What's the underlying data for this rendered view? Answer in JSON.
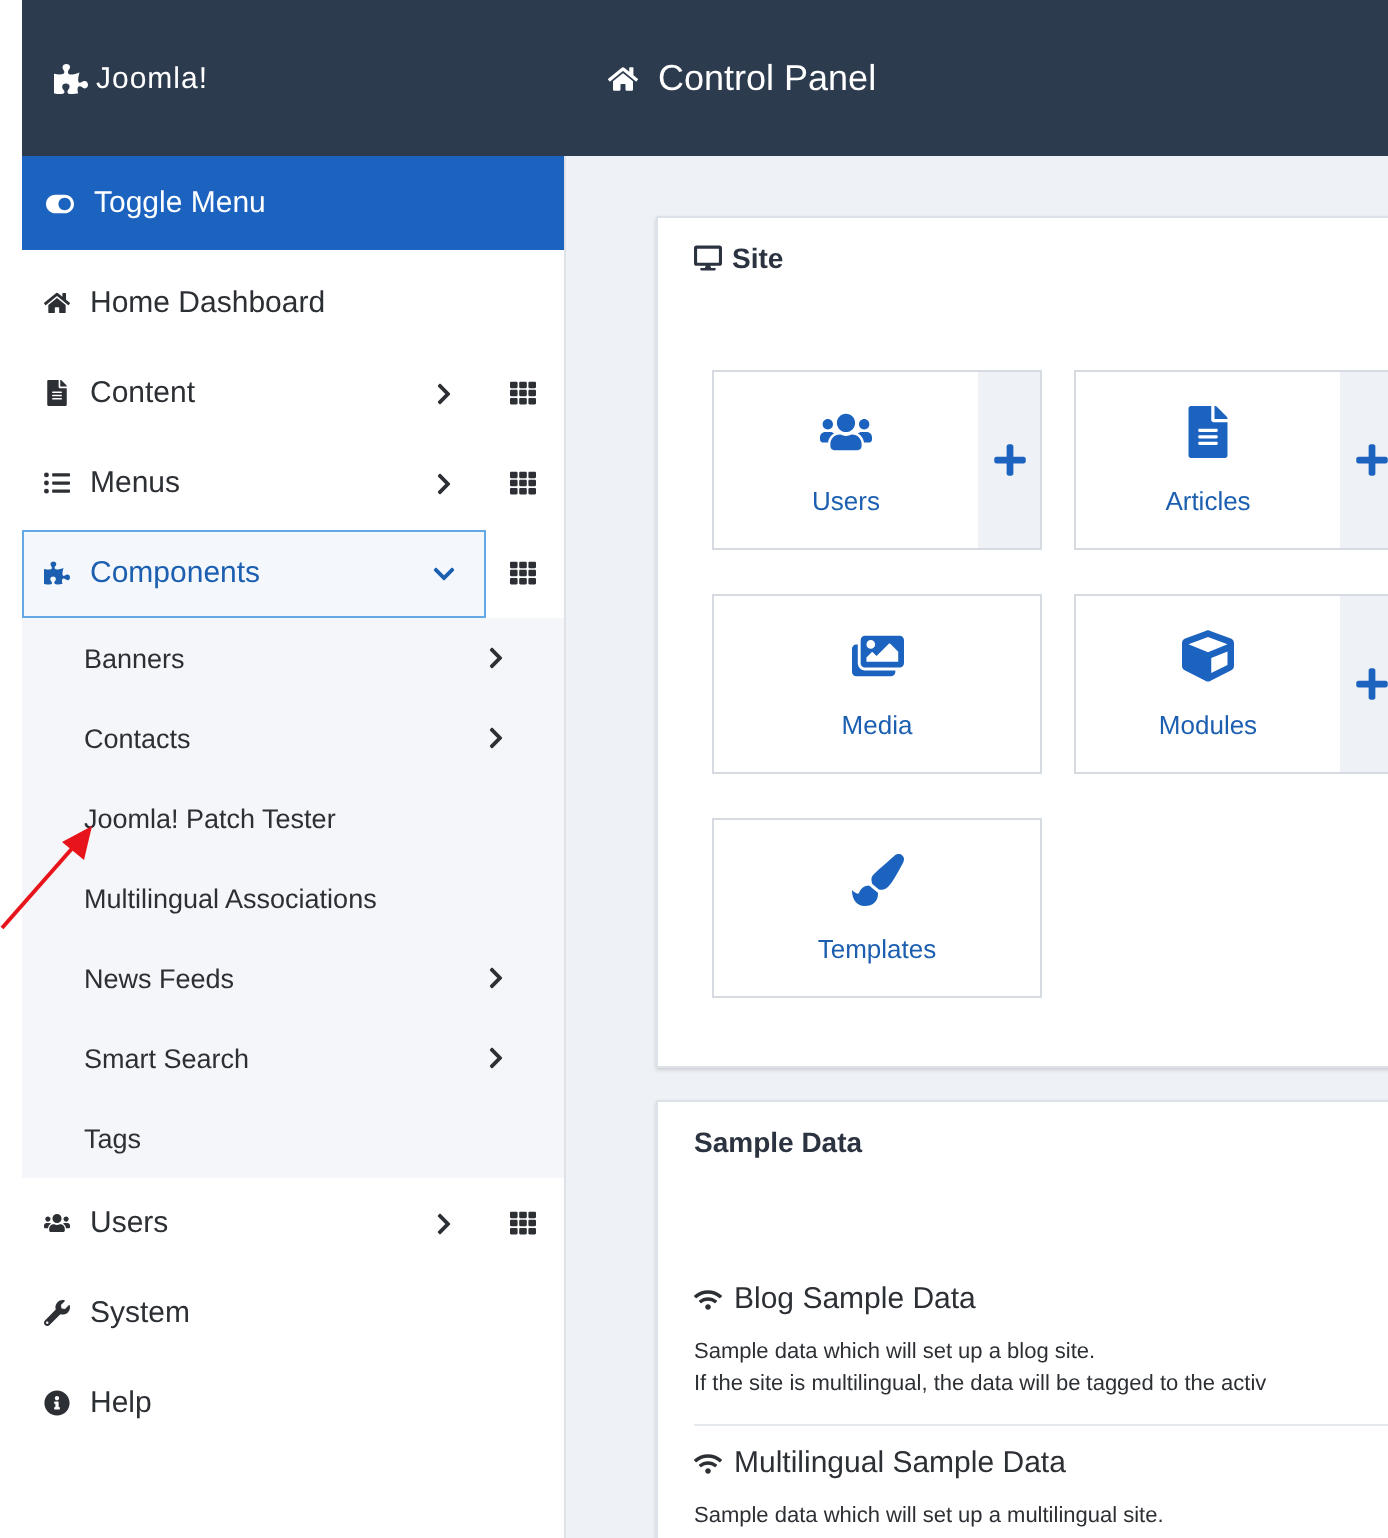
{
  "header": {
    "brand": "Joomla!",
    "page_title": "Control Panel"
  },
  "sidebar": {
    "toggle": "Toggle Menu",
    "items": [
      {
        "label": "Home Dashboard",
        "has_arrow": false,
        "has_grid": false,
        "selected": false
      },
      {
        "label": "Content",
        "has_arrow": true,
        "has_grid": true,
        "expanded": false,
        "selected": false
      },
      {
        "label": "Menus",
        "has_arrow": true,
        "has_grid": true,
        "expanded": false,
        "selected": false
      },
      {
        "label": "Components",
        "has_arrow": true,
        "has_grid": true,
        "expanded": true,
        "selected": true,
        "children": [
          {
            "label": "Banners",
            "has_arrow": true
          },
          {
            "label": "Contacts",
            "has_arrow": true
          },
          {
            "label": "Joomla! Patch Tester",
            "has_arrow": false
          },
          {
            "label": "Multilingual Associations",
            "has_arrow": false
          },
          {
            "label": "News Feeds",
            "has_arrow": true
          },
          {
            "label": "Smart Search",
            "has_arrow": true
          },
          {
            "label": "Tags",
            "has_arrow": false
          }
        ]
      },
      {
        "label": "Users",
        "has_arrow": true,
        "has_grid": true,
        "expanded": false,
        "selected": false
      },
      {
        "label": "System",
        "has_arrow": false,
        "has_grid": false,
        "selected": false
      },
      {
        "label": "Help",
        "has_arrow": false,
        "has_grid": false,
        "selected": false
      }
    ]
  },
  "site": {
    "title": "Site",
    "tiles": [
      {
        "label": "Users",
        "add": true
      },
      {
        "label": "Articles",
        "add": true
      },
      {
        "label": "Media",
        "add": false
      },
      {
        "label": "Modules",
        "add": true
      },
      {
        "label": "Templates",
        "add": false
      }
    ]
  },
  "sample_data": {
    "title": "Sample Data",
    "entries": [
      {
        "title": "Blog Sample Data",
        "lines": [
          "Sample data which will set up a blog site.",
          "If the site is multilingual, the data will be tagged to the activ"
        ]
      },
      {
        "title": "Multilingual Sample Data",
        "lines": [
          "Sample data which will set up a multilingual site."
        ]
      }
    ]
  }
}
